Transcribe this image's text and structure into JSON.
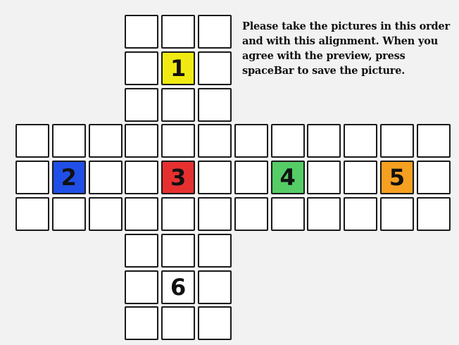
{
  "instructions": "Please take the pictures in this order and with this alignment. When you agree with the preview, press spaceBar to save the picture.",
  "faces": [
    {
      "label": "1",
      "color": "#f0ea12"
    },
    {
      "label": "2",
      "color": "#1f4fe6"
    },
    {
      "label": "3",
      "color": "#e63030"
    },
    {
      "label": "4",
      "color": "#55cc66"
    },
    {
      "label": "5",
      "color": "#f5a020"
    },
    {
      "label": "6",
      "color": "#ffffff"
    }
  ],
  "empty_cell_color": "#ffffff",
  "grid_line_color": "#1a1a1a",
  "background_color": "#f2f2f2"
}
